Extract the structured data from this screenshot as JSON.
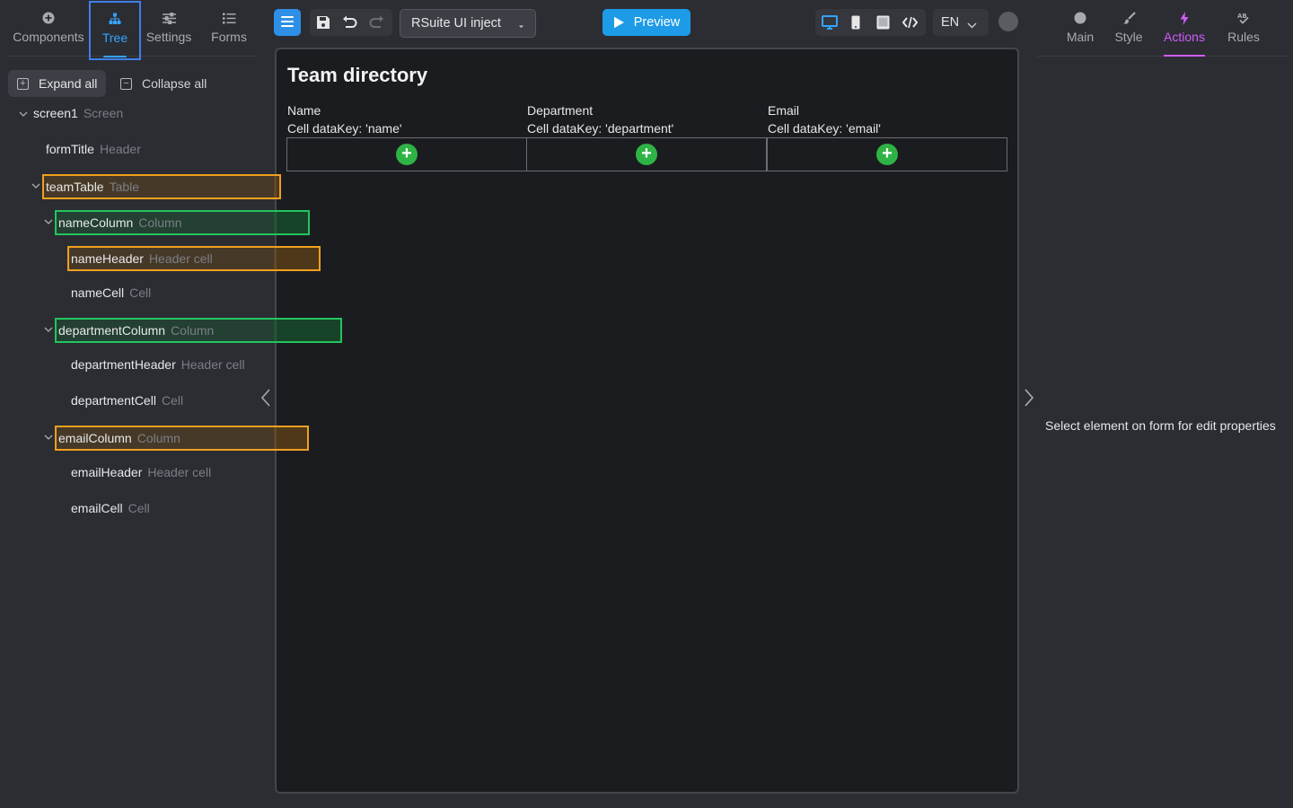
{
  "left_tabs": [
    {
      "label": "Components",
      "icon": "plus-circle-icon"
    },
    {
      "label": "Tree",
      "icon": "sitemap-icon",
      "active": true
    },
    {
      "label": "Settings",
      "icon": "sliders-icon"
    },
    {
      "label": "Forms",
      "icon": "list-icon"
    }
  ],
  "tree_actions": {
    "expand_all": "Expand all",
    "collapse_all": "Collapse all"
  },
  "tree": [
    {
      "name": "screen1",
      "type": "Screen",
      "expanded": true
    },
    {
      "name": "formTitle",
      "type": "Header"
    },
    {
      "name": "teamTable",
      "type": "Table",
      "expanded": true,
      "highlight": "orange"
    },
    {
      "name": "nameColumn",
      "type": "Column",
      "expanded": true,
      "highlight": "green"
    },
    {
      "name": "nameHeader",
      "type": "Header cell",
      "highlight": "orange"
    },
    {
      "name": "nameCell",
      "type": "Cell"
    },
    {
      "name": "departmentColumn",
      "type": "Column",
      "expanded": true,
      "highlight": "green"
    },
    {
      "name": "departmentHeader",
      "type": "Header cell"
    },
    {
      "name": "departmentCell",
      "type": "Cell"
    },
    {
      "name": "emailColumn",
      "type": "Column",
      "expanded": true,
      "highlight": "orange"
    },
    {
      "name": "emailHeader",
      "type": "Header cell"
    },
    {
      "name": "emailCell",
      "type": "Cell"
    }
  ],
  "toolbar": {
    "form_select": "RSuite UI inject",
    "preview_label": "Preview",
    "language": "EN"
  },
  "canvas": {
    "form_title": "Team directory",
    "columns": [
      {
        "header": "Name",
        "cell_key": "Cell dataKey: 'name'"
      },
      {
        "header": "Department",
        "cell_key": "Cell dataKey: 'department'"
      },
      {
        "header": "Email",
        "cell_key": "Cell dataKey: 'email'"
      }
    ]
  },
  "right_tabs": [
    {
      "label": "Main",
      "icon": "circle-icon"
    },
    {
      "label": "Style",
      "icon": "brush-icon"
    },
    {
      "label": "Actions",
      "icon": "lightning-icon",
      "active": true
    },
    {
      "label": "Rules",
      "icon": "rules-icon"
    }
  ],
  "properties_hint": "Select element on form for edit properties",
  "colors": {
    "accent_blue": "#34a3ff",
    "accent_purple": "#d35bff",
    "highlight_orange": "#f0a01e",
    "highlight_green": "#22c55e",
    "add_green": "#2fb344"
  }
}
